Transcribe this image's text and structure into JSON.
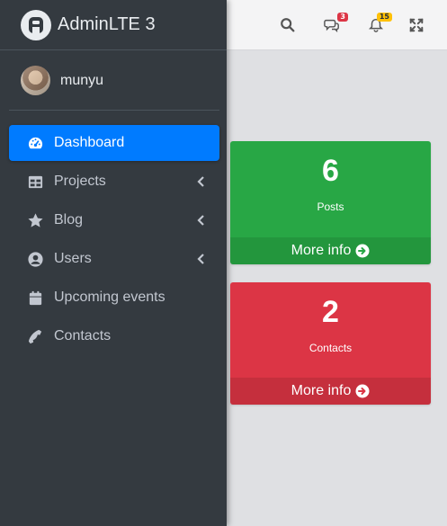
{
  "brand": {
    "title": "AdminLTE 3",
    "logo_icon": "adminlte-logo-icon"
  },
  "user": {
    "name": "munyu"
  },
  "navbar": {
    "icons": [
      "search-icon",
      "comments-icon",
      "bell-icon",
      "expand-icon"
    ],
    "messages_badge": "3",
    "notifications_badge": "15"
  },
  "sidebar": {
    "items": [
      {
        "label": "Dashboard",
        "icon": "tachometer-icon",
        "active": true,
        "has_submenu": false
      },
      {
        "label": "Projects",
        "icon": "table-icon",
        "active": false,
        "has_submenu": true
      },
      {
        "label": "Blog",
        "icon": "star-icon",
        "active": false,
        "has_submenu": true
      },
      {
        "label": "Users",
        "icon": "user-circle-icon",
        "active": false,
        "has_submenu": true
      },
      {
        "label": "Upcoming events",
        "icon": "calendar-icon",
        "active": false,
        "has_submenu": false
      },
      {
        "label": "Contacts",
        "icon": "phone-icon",
        "active": false,
        "has_submenu": false
      }
    ]
  },
  "cards": [
    {
      "number": "6",
      "label": "Posts",
      "footer": "More info",
      "color": "#28a745"
    },
    {
      "number": "2",
      "label": "Contacts",
      "footer": "More info",
      "color": "#dc3545"
    }
  ],
  "colors": {
    "sidebar": "#343a40",
    "active": "#007bff",
    "success": "#28a745",
    "danger": "#dc3545",
    "warning": "#ffc107"
  }
}
